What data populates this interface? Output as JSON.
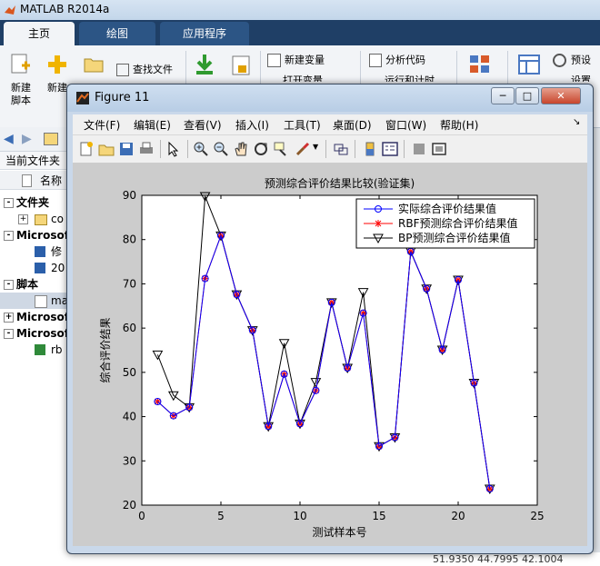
{
  "matlab": {
    "title": "MATLAB R2014a",
    "tabs": [
      "主页",
      "绘图",
      "应用程序"
    ],
    "ribbon": {
      "new_script": "新建\n脚本",
      "new": "新建",
      "find_files": "查找文件",
      "new_variable": "新建变量",
      "open_variable": "打开变量",
      "analyze_code": "分析代码",
      "run_and_time": "运行和计时",
      "preferences": "预设",
      "set_path": "设置路"
    },
    "current_folder": {
      "title": "当前文件夹",
      "column_name": "名称",
      "rows": [
        {
          "label": "文件夹",
          "bold": true,
          "toggle": "-"
        },
        {
          "label": "co",
          "bold": false,
          "toggle": "+"
        },
        {
          "label": "Microsof",
          "bold": true,
          "toggle": "-"
        },
        {
          "label": "修",
          "bold": false,
          "toggle": ""
        },
        {
          "label": "20",
          "bold": false,
          "toggle": ""
        },
        {
          "label": "脚本",
          "bold": true,
          "toggle": "-"
        },
        {
          "label": "ma",
          "bold": false,
          "toggle": "",
          "selected": true
        },
        {
          "label": "Microsof",
          "bold": true,
          "toggle": "+"
        },
        {
          "label": "Microsof",
          "bold": true,
          "toggle": "-"
        },
        {
          "label": "rb",
          "bold": false,
          "toggle": ""
        }
      ]
    },
    "bottom_values": "51.9350    44.7995    42.1004"
  },
  "figure": {
    "title": "Figure 11",
    "menu": [
      "文件(F)",
      "编辑(E)",
      "查看(V)",
      "插入(I)",
      "工具(T)",
      "桌面(D)",
      "窗口(W)",
      "帮助(H)"
    ],
    "toolbar_icons": [
      "new-figure-icon",
      "open-icon",
      "save-icon",
      "print-icon",
      "pointer-icon",
      "zoom-in-icon",
      "zoom-out-icon",
      "pan-icon",
      "rotate-icon",
      "data-cursor-icon",
      "brush-icon",
      "link-icon",
      "colorbar-icon",
      "legend-icon",
      "hide-plot-tools-icon",
      "show-plot-tools-icon"
    ]
  },
  "chart_data": {
    "type": "line",
    "title": "预测综合评价结果比较(验证集)",
    "xlabel": "测试样本号",
    "ylabel": "综合评价结果",
    "xlim": [
      0,
      25
    ],
    "ylim": [
      20,
      90
    ],
    "xticks": [
      0,
      5,
      10,
      15,
      20,
      25
    ],
    "yticks": [
      20,
      30,
      40,
      50,
      60,
      70,
      80,
      90
    ],
    "legend_position": "top-right",
    "x": [
      1,
      2,
      3,
      4,
      5,
      6,
      7,
      8,
      9,
      10,
      11,
      12,
      13,
      14,
      15,
      16,
      17,
      18,
      19,
      20,
      21,
      22
    ],
    "series": [
      {
        "name": "实际综合评价结果值",
        "color": "#0000ff",
        "marker": "circle",
        "values": [
          43.4,
          40.2,
          42.1,
          71.2,
          80.9,
          67.6,
          59.5,
          37.8,
          49.6,
          38.4,
          45.9,
          65.8,
          51.0,
          63.4,
          33.3,
          35.3,
          77.3,
          68.9,
          55.1,
          70.9,
          47.6,
          23.7
        ]
      },
      {
        "name": "RBF预测综合评价结果值",
        "color": "#ff0000",
        "marker": "star",
        "values": [
          43.4,
          40.2,
          42.1,
          71.2,
          80.9,
          67.6,
          59.5,
          37.8,
          49.6,
          38.4,
          45.9,
          65.8,
          51.0,
          63.4,
          33.3,
          35.3,
          77.3,
          68.9,
          55.1,
          70.9,
          47.6,
          23.7
        ]
      },
      {
        "name": "BP预测综合评价结果值",
        "color": "#000000",
        "marker": "triangle-down",
        "values": [
          54.0,
          44.8,
          42.1,
          89.8,
          80.9,
          67.6,
          59.5,
          37.8,
          56.6,
          38.4,
          47.8,
          65.8,
          51.0,
          68.1,
          33.3,
          35.3,
          77.3,
          68.9,
          55.1,
          70.9,
          47.6,
          23.7
        ]
      }
    ]
  }
}
